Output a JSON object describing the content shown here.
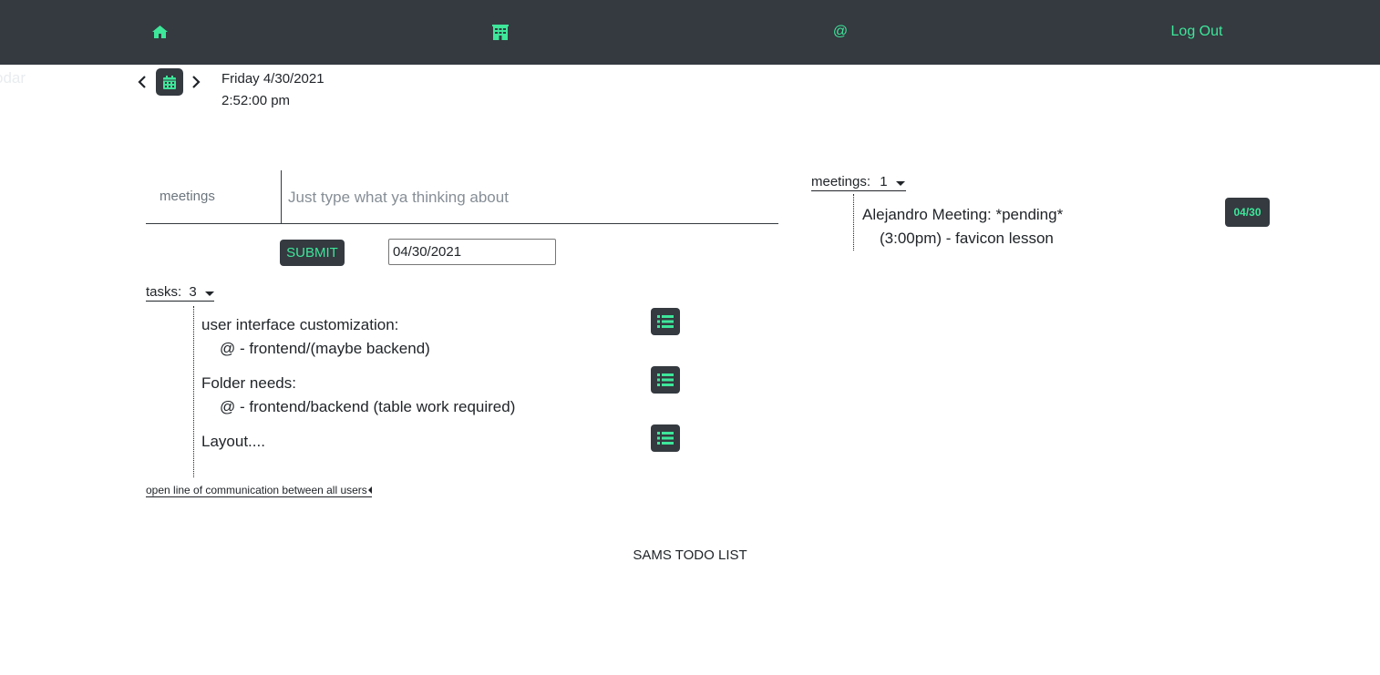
{
  "navbar": {
    "home_icon": "home-icon",
    "building_icon": "building-icon",
    "at_label": "@",
    "logout_label": "Log Out",
    "accent_color": "#3ee69a",
    "background_color": "#343a40"
  },
  "ghost_text": "odar",
  "date_nav": {
    "prev_icon": "chevron-left-icon",
    "calendar_icon": "calendar-icon",
    "next_icon": "chevron-right-icon",
    "date": "Friday 4/30/2021",
    "time": "2:52:00 pm"
  },
  "entry": {
    "category": "meetings",
    "placeholder": "Just type what ya thinking about",
    "value": "",
    "submit_label": "SUBMIT",
    "date_value": "04/30/2021"
  },
  "tasks": {
    "label": "tasks:",
    "count": "3",
    "items": [
      {
        "title": "user interface customization:",
        "subtitle": "@ - frontend/(maybe backend)"
      },
      {
        "title": "Folder needs:",
        "subtitle": "@ - frontend/backend (table work required)"
      },
      {
        "title": "Layout....",
        "subtitle": ""
      }
    ],
    "item_button_icon": "list-icon"
  },
  "meetings": {
    "label": "meetings:",
    "count": "1",
    "items": [
      {
        "title": "Alejandro Meeting: *pending*",
        "subtitle": "(3:00pm) - favicon lesson",
        "badge": "04/30"
      }
    ]
  },
  "footer": {
    "link_label": "open line of communication between all users",
    "title": "SAMS TODO LIST"
  }
}
